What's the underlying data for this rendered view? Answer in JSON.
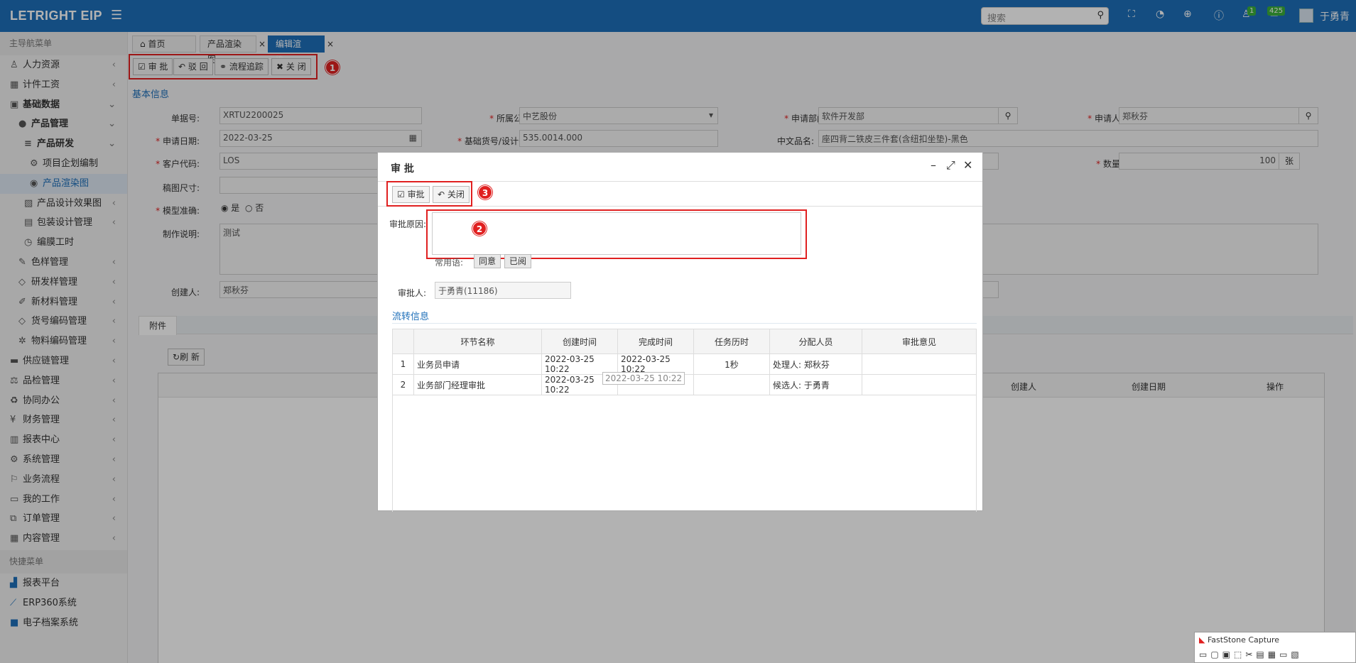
{
  "topbar": {
    "logo": "LETRIGHT EIP",
    "search_placeholder": "搜索",
    "badge1": "1",
    "badge2": "425",
    "user": "于勇青"
  },
  "sidebar": {
    "header": "主导航菜单",
    "quick_header": "快捷菜单",
    "items": [
      "人力资源",
      "计件工资",
      "基础数据",
      "产品管理",
      "产品研发",
      "项目企划编制",
      "产品渲染图",
      "产品设计效果图",
      "包装设计管理",
      "编膜工时",
      "色样管理",
      "研发样管理",
      "新材料管理",
      "货号编码管理",
      "物料编码管理",
      "供应链管理",
      "品检管理",
      "协同办公",
      "财务管理",
      "报表中心",
      "系统管理",
      "业务流程",
      "我的工作",
      "订单管理",
      "内容管理"
    ],
    "quick": [
      "报表平台",
      "ERP360系统",
      "电子档案系统"
    ]
  },
  "tabs": [
    "首页",
    "产品渲染图",
    "编辑渲染..."
  ],
  "toolbar": {
    "approve": "审 批",
    "reject": "驳 回",
    "trace": "流程追踪",
    "close": "关 闭"
  },
  "section": "基本信息",
  "form": {
    "order_no_label": "单据号:",
    "order_no": "XRTU2200025",
    "company_label": "所属公司:",
    "company": "中艺股份",
    "dept_label": "申请部门:",
    "dept": "软件开发部",
    "applicant_label": "申请人:",
    "applicant": "郑秋芬",
    "date_label": "申请日期:",
    "date": "2022-03-25",
    "base_no_label": "基础货号/设计号:",
    "base_no": "535.0014.000",
    "cn_name_label": "中文品名:",
    "cn_name": "座四背二铁皮三件套(含纽扣坐垫)-黑色",
    "customer_label": "客户代码:",
    "customer": "LOS",
    "qty_label": "数量:",
    "qty": "100",
    "unit": "张",
    "size_label": "稿图尺寸:",
    "model_label": "模型准确:",
    "yes": "是",
    "no": "否",
    "desc_label": "制作说明:",
    "desc": "测试",
    "creator_label": "创建人:",
    "creator": "郑秋芬"
  },
  "attach": {
    "tab": "附件",
    "refresh": "刷 新",
    "col_creator": "创建人",
    "col_date": "创建日期",
    "col_op": "操作"
  },
  "dialog": {
    "title": "审 批",
    "approve": "审批",
    "close": "关闭",
    "reason_label": "审批原因:",
    "common_label": "常用语:",
    "agree": "同意",
    "read": "已阅",
    "approver_label": "审批人:",
    "approver": "于勇青(11186)",
    "flow_title": "流转信息",
    "headers": [
      "",
      "环节名称",
      "创建时间",
      "完成时间",
      "任务历时",
      "分配人员",
      "审批意见"
    ],
    "rows": [
      [
        "1",
        "业务员申请",
        "2022-03-25 10:22",
        "2022-03-25 10:22",
        "1秒",
        "处理人: 郑秋芬",
        ""
      ],
      [
        "2",
        "业务部门经理审批",
        "2022-03-25 10:22",
        "",
        "",
        "候选人: 于勇青",
        ""
      ]
    ],
    "tooltip": "2022-03-25 10:22"
  },
  "markers": [
    "1",
    "2",
    "3"
  ],
  "faststone": "FastStone Capture"
}
